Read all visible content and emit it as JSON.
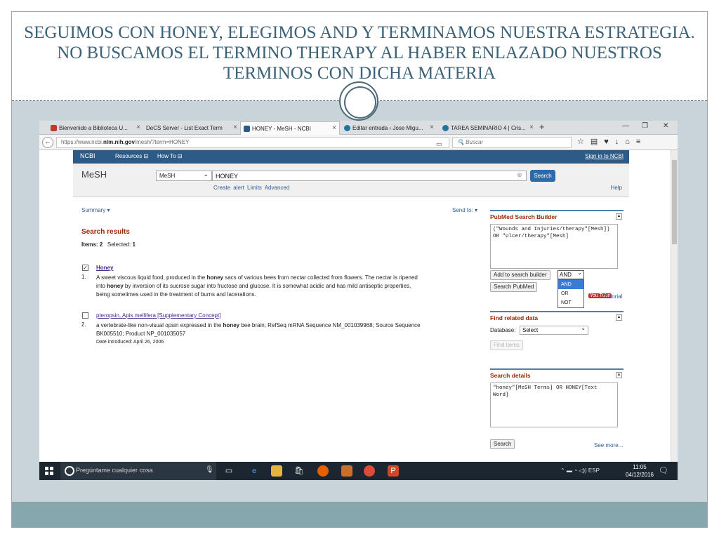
{
  "slide": {
    "title": "SEGUIMOS CON HONEY,  ELEGIMOS AND Y TERMINAMOS  NUESTRA ESTRATEGIA. NO BUSCAMOS EL TERMINO THERAPY AL HABER ENLAZADO NUESTROS TERMINOS CON DICHA MATERIA"
  },
  "browser": {
    "tabs": [
      {
        "label": "Bienvenido a Biblioteca U...",
        "icon": "library-icon",
        "color": "#c0392b"
      },
      {
        "label": "DeCS Server - List Exact Term",
        "icon": "page-icon",
        "color": "#9aa3ab"
      },
      {
        "label": "HONEY - MeSH - NCBI",
        "icon": "ncbi-icon",
        "color": "#2d5b87"
      },
      {
        "label": "Editar entrada ‹ Jose Migu...",
        "icon": "wordpress-icon",
        "color": "#21759b"
      },
      {
        "label": "TAREA SEMINARIO 4 | Cris...",
        "icon": "wordpress-icon",
        "color": "#21759b"
      }
    ],
    "url_prefix": "https://www.ncbi.",
    "url_domain": "nlm.nih.gov",
    "url_path": "/mesh/?term=HONEY",
    "search_placeholder": "Buscar"
  },
  "ncbi": {
    "logo": "NCBI",
    "resources": "Resources ⊟",
    "howto": "How To ⊟",
    "signin": "Sign in to NCBI",
    "db_label": "MeSH",
    "db_select": "MeSH",
    "term": "HONEY",
    "search_btn": "Search",
    "create_alert": "Create alert",
    "limits": "Limits",
    "advanced": "Advanced",
    "help": "Help"
  },
  "results": {
    "summary": "Summary ▾",
    "sendto": "Send to: ▾",
    "heading": "Search results",
    "items_label": "Items: 2",
    "selected_label": "Selected:",
    "selected_count": "1",
    "items": [
      {
        "num": "1.",
        "checked": "✓",
        "title": "Honey",
        "line1_a": "A sweet viscous liquid food, produced in the ",
        "line1_b": "honey",
        "line1_c": " sacs of various bees from nectar collected from flowers. The nectar is ripened",
        "line2_a": "into ",
        "line2_b": "honey",
        "line2_c": " by inversion of its sucrose sugar into fructose and glucose. It is somewhat acidic and has mild antiseptic properties,",
        "line3": "being sometimes used in the treatment of burns and lacerations."
      },
      {
        "num": "2.",
        "checked": "",
        "title": "pteropsin, Apis mellifera [Supplementary Concept]",
        "line1_a": "a vertebrate-like non-visual opsin expressed in the ",
        "line1_b": "honey",
        "line1_c": " bee brain; RefSeq mRNA Sequence NM_001039968; Source Sequence",
        "line2": "BK005510; Product NP_001035057",
        "date": "Date introduced: April 26, 2006"
      }
    ]
  },
  "sidebar": {
    "builder_title": "PubMed Search Builder",
    "builder_query": "(\"Wounds and Injuries/therapy\"[Mesh]) OR \"Ulcer/therapy\"[Mesh]",
    "add_btn": "Add to search builder",
    "operator": "AND",
    "operator_options": [
      "AND",
      "OR",
      "NOT"
    ],
    "search_pubmed": "Search PubMed",
    "youtube": "You Tube",
    "tutorial": "Tutorial",
    "related_title": "Find related data",
    "database_label": "Database:",
    "database_value": "Select",
    "find_items": "Find items",
    "details_title": "Search details",
    "details_query": "\"honey\"[MeSH Terms] OR HONEY[Text Word]",
    "details_search": "Search",
    "see_more": "See more..."
  },
  "taskbar": {
    "cortana": "Pregúntame cualquier cosa",
    "lang": "ESP",
    "time": "11:05",
    "date": "04/12/2016"
  }
}
